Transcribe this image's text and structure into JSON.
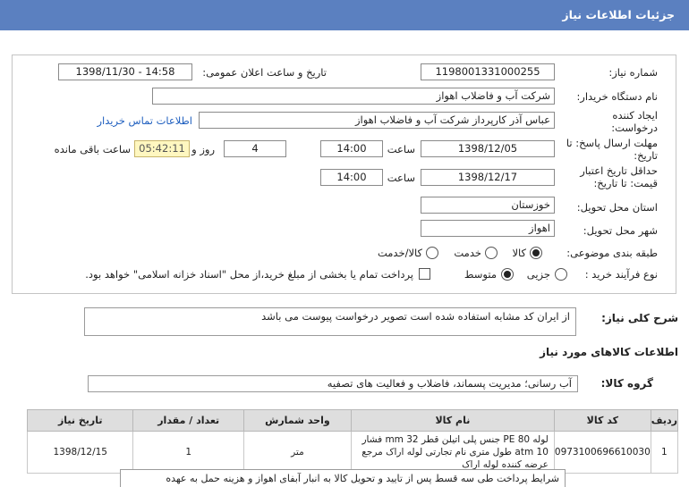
{
  "header": {
    "title": "جزئیات اطلاعات نیاز"
  },
  "info": {
    "need_number_label": "شماره نیاز:",
    "need_number": "1198001331000255",
    "announce_label": "تاریخ و ساعت اعلان عمومی:",
    "announce_value": "1398/11/30 - 14:58",
    "buyer_label": "نام دستگاه خریدار:",
    "buyer_value": "شرکت آب و فاضلاب اهواز",
    "creator_label": "ایجاد کننده درخواست:",
    "creator_value": "عباس آذر کارپرداز شرکت آب و فاضلاب اهواز",
    "contact_link": "اطلاعات تماس خریدار",
    "deadline_label": "مهلت ارسال پاسخ: تا تاریخ:",
    "deadline_date": "1398/12/05",
    "time_label": "ساعت",
    "deadline_time": "14:00",
    "days_value": "4",
    "day_and_label": "روز و",
    "remaining_time": "05:42:11",
    "remaining_label": "ساعت باقی مانده",
    "validity_label": "حداقل تاریخ اعتبار قیمت: تا تاریخ:",
    "validity_date": "1398/12/17",
    "validity_time": "14:00",
    "province_label": "استان محل تحویل:",
    "province_value": "خوزستان",
    "city_label": "شهر محل تحویل:",
    "city_value": "اهواز",
    "category_label": "طبقه بندی موضوعی:",
    "category_options": [
      "کالا",
      "خدمت",
      "کالا/خدمت"
    ],
    "category_selected": "کالا",
    "process_label": "نوع فرآیند خرید :",
    "process_options": [
      "جزیی",
      "متوسط"
    ],
    "process_selected": "متوسط",
    "payment_note": "پرداخت تمام یا بخشی از مبلغ خرید،از محل \"اسناد خزانه اسلامی\" خواهد بود."
  },
  "description": {
    "label": "شرح کلی نیاز:",
    "value": "از ایران کد مشابه استفاده شده است تصویر درخواست پیوست می باشد"
  },
  "goods_section": {
    "title": "اطلاعات کالاهای مورد نیاز"
  },
  "group": {
    "label": "گروه کالا:",
    "value": "آب رسانی؛ مدیریت پسماند، فاضلاب و فعالیت های تصفیه"
  },
  "table": {
    "headers": [
      "ردیف",
      "کد کالا",
      "نام کالا",
      "واحد شمارش",
      "تعداد / مقدار",
      "تاریخ نیاز"
    ],
    "rows": [
      {
        "row": "1",
        "code": "0973100696610030",
        "name": "لوله PE 80 جنس پلی اتیلن قطر 32 mm فشار 10 atm طول متری نام تجارتی لوله اراک مرجع عرضه کننده لوله اراک",
        "unit": "متر",
        "qty": "1",
        "date": "1398/12/15"
      }
    ]
  },
  "conditions": {
    "label": "شرایط",
    "value": "پرداخت طی سه قسط پس از تایید و تحویل کالا به انبار آبفای اهواز و هزینه حمل به عهده"
  }
}
